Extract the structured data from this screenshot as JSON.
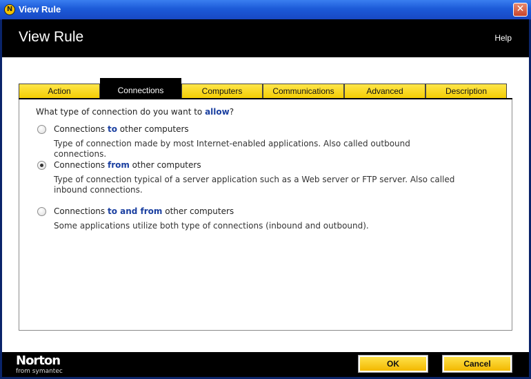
{
  "window": {
    "title": "View Rule",
    "close_symbol": "✕",
    "app_icon_letter": "N"
  },
  "header": {
    "title": "View Rule",
    "help": "Help"
  },
  "tabs": [
    {
      "label": "Action",
      "active": false
    },
    {
      "label": "Connections",
      "active": true
    },
    {
      "label": "Computers",
      "active": false
    },
    {
      "label": "Communications",
      "active": false
    },
    {
      "label": "Advanced",
      "active": false
    },
    {
      "label": "Description",
      "active": false
    }
  ],
  "content": {
    "question_prefix": "What type of connection do you want to ",
    "question_keyword": "allow",
    "question_suffix": "?",
    "options": [
      {
        "prefix": "Connections ",
        "keyword": "to",
        "suffix": " other computers",
        "description": "Type of connection made by most Internet-enabled applications. Also called outbound connections.",
        "selected": false
      },
      {
        "prefix": "Connections ",
        "keyword": "from",
        "suffix": " other computers",
        "description": "Type of connection typical of a server application such as a Web server or FTP server. Also called inbound connections.",
        "selected": true
      },
      {
        "prefix": "Connections ",
        "keyword": "to and from",
        "suffix": " other computers",
        "description": "Some applications utilize both type of connections (inbound and outbound).",
        "selected": false
      }
    ]
  },
  "footer": {
    "brand": "Norton",
    "brand_sub": "from symantec",
    "ok": "OK",
    "cancel": "Cancel"
  },
  "colors": {
    "accent_yellow": "#f3cc00",
    "keyword_blue": "#1a3fa0",
    "titlebar_blue": "#1c5ad8"
  }
}
